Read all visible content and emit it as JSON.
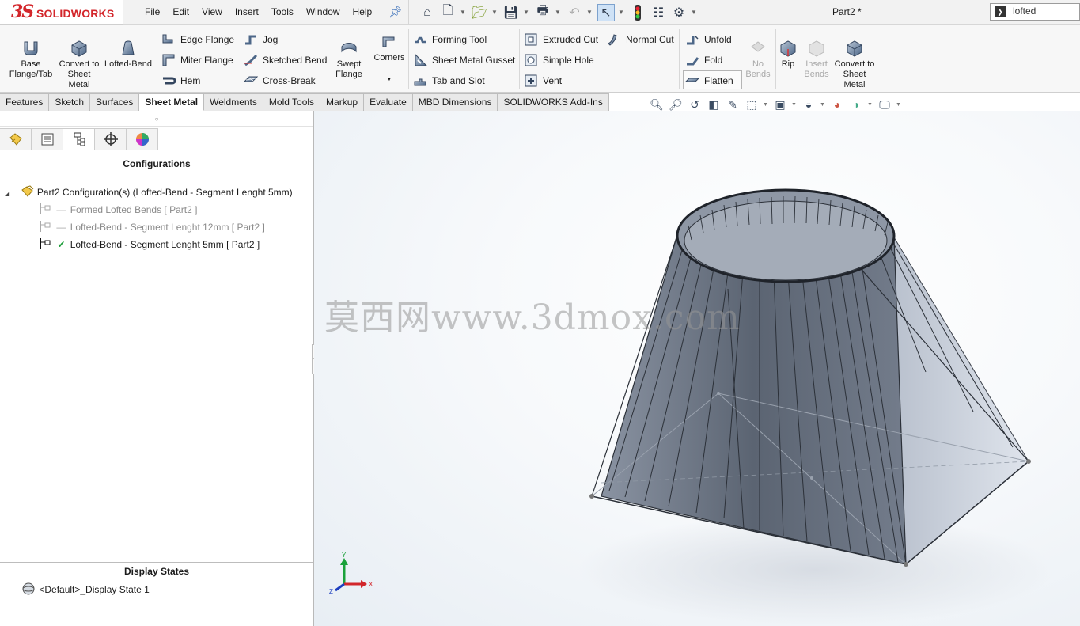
{
  "app": {
    "logo_ds": "3S",
    "logo_text": "SOLIDWORKS",
    "document_title": "Part2 *"
  },
  "menu": [
    "File",
    "Edit",
    "View",
    "Insert",
    "Tools",
    "Window",
    "Help"
  ],
  "search": {
    "value": "lofted"
  },
  "ribbon": {
    "base_flange": "Base Flange/Tab",
    "convert_to_sheet_metal": "Convert to Sheet Metal",
    "lofted_bend": "Lofted-Bend",
    "edge_flange": "Edge Flange",
    "miter_flange": "Miter Flange",
    "hem": "Hem",
    "jog": "Jog",
    "sketched_bend": "Sketched Bend",
    "cross_break": "Cross-Break",
    "swept_flange": "Swept Flange",
    "corners": "Corners",
    "forming_tool": "Forming Tool",
    "sheet_metal_gusset": "Sheet Metal Gusset",
    "tab_and_slot": "Tab and Slot",
    "extruded_cut": "Extruded Cut",
    "simple_hole": "Simple Hole",
    "vent": "Vent",
    "normal_cut": "Normal Cut",
    "unfold": "Unfold",
    "fold": "Fold",
    "flatten": "Flatten",
    "no_bends": "No Bends",
    "rip": "Rip",
    "insert_bends": "Insert Bends",
    "convert_to_sheet_metal_2": "Convert to Sheet Metal"
  },
  "tabs": [
    "Features",
    "Sketch",
    "Surfaces",
    "Sheet Metal",
    "Weldments",
    "Mold Tools",
    "Markup",
    "Evaluate",
    "MBD Dimensions",
    "SOLIDWORKS Add-Ins"
  ],
  "active_tab": "Sheet Metal",
  "config_manager": {
    "header": "Configurations",
    "root": "Part2 Configuration(s)  (Lofted-Bend - Segment Lenght 5mm)",
    "items": [
      {
        "label": "Formed Lofted Bends [ Part2 ]",
        "active": false
      },
      {
        "label": "Lofted-Bend - Segment Lenght 12mm [ Part2 ]",
        "active": false
      },
      {
        "label": "Lofted-Bend - Segment Lenght 5mm [ Part2 ]",
        "active": true
      }
    ],
    "display_states_header": "Display States",
    "display_state": "<Default>_Display State 1"
  },
  "triad": {
    "x": "X",
    "y": "Y",
    "z": "Z"
  },
  "watermark": "莫西网www.3dmox.com",
  "colors": {
    "brand_red": "#d3262b",
    "model_fill": "#6f7888",
    "active_check": "#1e9e3a"
  }
}
